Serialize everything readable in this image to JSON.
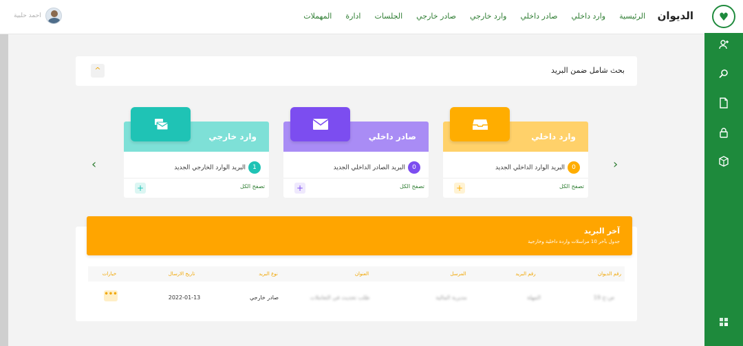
{
  "header": {
    "brand": "الديوان",
    "nav": [
      "الرئيسية",
      "وارد داخلي",
      "صادر داخلي",
      "وارد خارجي",
      "صادر خارجي",
      "الجلسات",
      "ادارة",
      "المهملات"
    ],
    "user_name": "احمد حلبية"
  },
  "sidebar": {
    "icons": [
      "add-user-icon",
      "search-key-icon",
      "document-icon",
      "lock-icon",
      "box-icon",
      "grid-icon"
    ]
  },
  "search_panel": {
    "title": "بحث شامل ضمن البريد",
    "toggle": "^"
  },
  "cards": [
    {
      "title": "وارد داخلي",
      "line": "البريد الوارد الداخلي الجديد",
      "count": "0",
      "view_all": "تصفح الكل",
      "color": "#ffd16a",
      "icon_color": "#ffad00",
      "icon": "inbox-icon"
    },
    {
      "title": "صادر داخلي",
      "line": "البريد الصادر الداخلي الجديد",
      "count": "0",
      "view_all": "تصفح الكل",
      "color": "#a98cf5",
      "icon_color": "#7c4df0",
      "icon": "envelope-icon"
    },
    {
      "title": "وارد خارجي",
      "line": "البريد الوارد الخارجي الجديد",
      "count": "1",
      "view_all": "تصفح الكل",
      "color": "#7ee0d7",
      "icon_color": "#1fc3b5",
      "icon": "mailbox-icon"
    }
  ],
  "latest_mail": {
    "title": "آخر البريد",
    "subtitle": "جدول بآخر 10 مراسلات واردة داخلية وخارجية",
    "columns": [
      "رقم الديوان",
      "رقم البريد",
      "المرسل",
      "العنوان",
      "نوع البريد",
      "تاريخ الارسال",
      "خيارات"
    ],
    "rows": [
      {
        "diwan_no": "ص-ج 19",
        "mail_no": "المهلة",
        "sender": "مديرية المالية",
        "subject": "طلب تحديث في التعاملات",
        "type": "صادر خارجي",
        "date": "2022-01-13",
        "options": "•••"
      }
    ]
  }
}
